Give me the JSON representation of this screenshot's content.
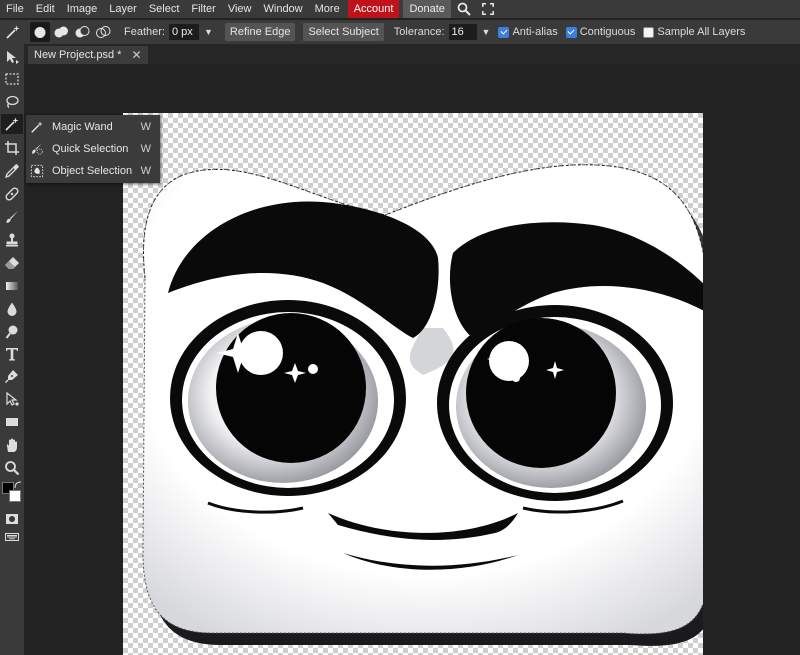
{
  "menubar": {
    "items": [
      "File",
      "Edit",
      "Image",
      "Layer",
      "Select",
      "Filter",
      "View",
      "Window",
      "More"
    ],
    "account": "Account",
    "donate": "Donate",
    "icons": [
      "search-icon",
      "fullscreen-icon"
    ]
  },
  "options": {
    "feather_label": "Feather:",
    "feather_value": "0 px",
    "refine_edge": "Refine Edge",
    "select_subject": "Select Subject",
    "tolerance_label": "Tolerance:",
    "tolerance_value": "16",
    "anti_alias": {
      "label": "Anti-alias",
      "checked": true
    },
    "contiguous": {
      "label": "Contiguous",
      "checked": true
    },
    "sample_all_layers": {
      "label": "Sample All Layers",
      "checked": false
    },
    "selection_modes": [
      "new-selection",
      "add-to-selection",
      "subtract-from-selection",
      "intersect-selection"
    ]
  },
  "tabs": [
    {
      "label": "New Project.psd *"
    }
  ],
  "flyout": {
    "items": [
      {
        "label": "Magic Wand",
        "shortcut": "W",
        "icon": "magic-wand-icon"
      },
      {
        "label": "Quick Selection",
        "shortcut": "W",
        "icon": "quick-selection-icon"
      },
      {
        "label": "Object Selection",
        "shortcut": "W",
        "icon": "object-selection-icon"
      }
    ]
  },
  "toolbar": {
    "tools": [
      "move",
      "marquee",
      "lasso",
      "magic-wand",
      "crop",
      "eyedropper",
      "healing",
      "brush",
      "stamp",
      "eraser",
      "gradient",
      "blur",
      "dodge",
      "type",
      "pen",
      "path-select",
      "rectangle",
      "hand",
      "zoom"
    ]
  },
  "colors": {
    "foreground": "#000000",
    "background": "#ffffff",
    "accent_account": "#c0121b",
    "checkbox": "#3d7fdc"
  }
}
